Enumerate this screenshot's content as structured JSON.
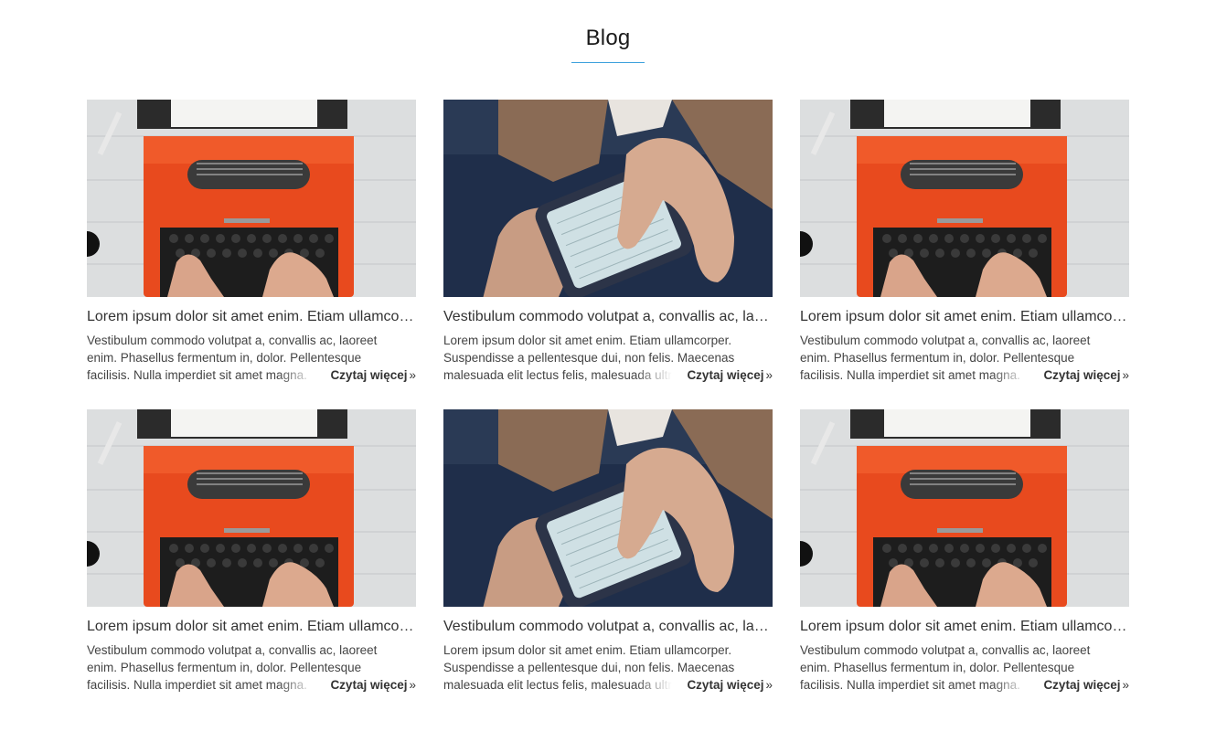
{
  "page": {
    "heading": "Blog",
    "accent_color": "#3ba0dc"
  },
  "posts": [
    {
      "image": "typewriter-photo",
      "title": "Lorem ipsum dolor sit amet enim. Etiam ullamcorper.",
      "excerpt": "Vestibulum commodo volutpat a, convallis ac, laoreet enim. Phasellus fermentum in, dolor. Pellentesque facilisis. Nulla imperdiet sit amet magna.",
      "read_more": "Czytaj więcej",
      "read_more_icon": "»"
    },
    {
      "image": "smartphone-hands-photo",
      "title": "Vestibulum commodo volutpat a, convallis ac, laoreet enim.",
      "excerpt": "Lorem ipsum dolor sit amet enim. Etiam ullamcorper. Suspendisse a pellentesque dui, non felis. Maecenas malesuada elit lectus felis, malesuada ultricies.",
      "read_more": "Czytaj więcej",
      "read_more_icon": "»"
    },
    {
      "image": "typewriter-photo",
      "title": "Lorem ipsum dolor sit amet enim. Etiam ullamcorper.",
      "excerpt": "Vestibulum commodo volutpat a, convallis ac, laoreet enim. Phasellus fermentum in, dolor. Pellentesque facilisis. Nulla imperdiet sit amet magna.",
      "read_more": "Czytaj więcej",
      "read_more_icon": "»"
    },
    {
      "image": "typewriter-photo",
      "title": "Lorem ipsum dolor sit amet enim. Etiam ullamcorper.",
      "excerpt": "Vestibulum commodo volutpat a, convallis ac, laoreet enim. Phasellus fermentum in, dolor. Pellentesque facilisis. Nulla imperdiet sit amet magna.",
      "read_more": "Czytaj więcej",
      "read_more_icon": "»"
    },
    {
      "image": "smartphone-hands-photo",
      "title": "Vestibulum commodo volutpat a, convallis ac, laoreet enim.",
      "excerpt": "Lorem ipsum dolor sit amet enim. Etiam ullamcorper. Suspendisse a pellentesque dui, non felis. Maecenas malesuada elit lectus felis, malesuada ultricies.",
      "read_more": "Czytaj więcej",
      "read_more_icon": "»"
    },
    {
      "image": "typewriter-photo",
      "title": "Lorem ipsum dolor sit amet enim. Etiam ullamcorper.",
      "excerpt": "Vestibulum commodo volutpat a, convallis ac, laoreet enim. Phasellus fermentum in, dolor. Pellentesque facilisis. Nulla imperdiet sit amet magna.",
      "read_more": "Czytaj więcej",
      "read_more_icon": "»"
    }
  ]
}
